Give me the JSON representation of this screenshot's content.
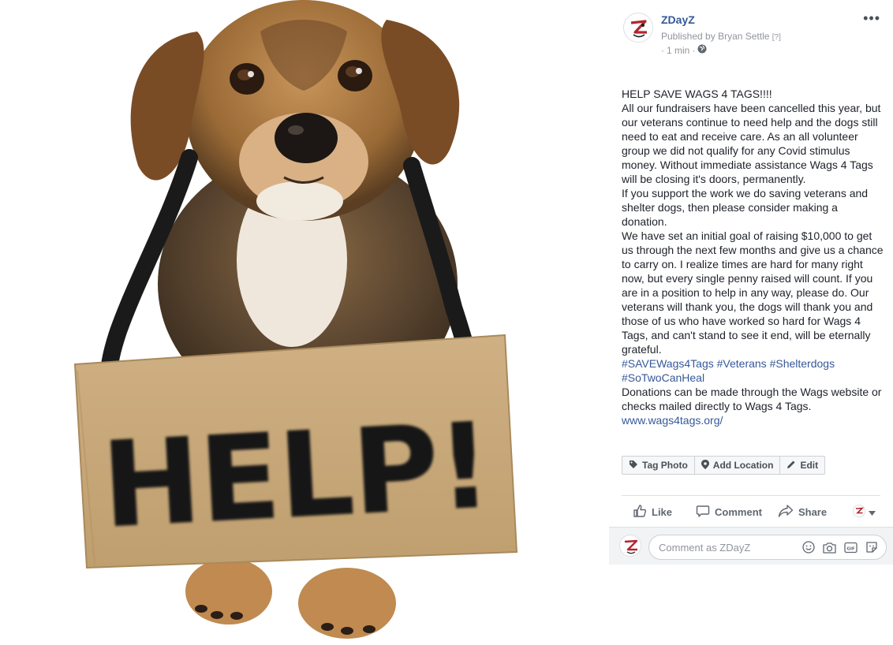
{
  "photo": {
    "sign_text": "HELP!"
  },
  "post": {
    "page_name": "ZDayZ",
    "published_prefix": "Published by",
    "publisher": "Bryan Settle",
    "publisher_help": "[?]",
    "time_prefix": "·",
    "time": "1 min",
    "time_separator": "·",
    "more_label": "•••",
    "body_lines": [
      "HELP SAVE WAGS 4 TAGS!!!!",
      "All our fundraisers have been cancelled this year, but our veterans continue to need help and the dogs still need to eat and receive care. As an all volunteer group we did not qualify for any Covid stimulus money. Without immediate assistance Wags 4 Tags will be closing it's doors, permanently.",
      "If you support the work we do saving veterans and shelter dogs, then please consider making a donation.",
      "We have set an initial goal of raising $10,000 to get us through the next few months and give us a chance to carry on. I realize times are hard for many right now, but every single penny raised will count. If you are in a position to help in any way, please do. Our veterans will thank you, the dogs will thank you and those of us who have worked so hard for Wags 4 Tags, and can't stand to see it end, will be eternally grateful."
    ],
    "hashtags": [
      "#SAVEWags4Tags",
      "#Veterans",
      "#Shelterdogs",
      "#SoTwoCanHeal"
    ],
    "donation_line": "Donations can be made through the Wags website or checks mailed directly to Wags 4 Tags.",
    "website": "www.wags4tags.org/"
  },
  "photo_actions": {
    "tag_photo": "Tag Photo",
    "add_location": "Add Location",
    "edit": "Edit"
  },
  "actions": {
    "like": "Like",
    "comment": "Comment",
    "share": "Share"
  },
  "comment": {
    "placeholder": "Comment as ZDayZ"
  },
  "colors": {
    "link": "#365899",
    "muted": "#90949c",
    "action": "#606770",
    "cardboard": "#c9a978",
    "brand_red": "#b3262e"
  },
  "icons": [
    "globe-icon",
    "tag-icon",
    "location-pin-icon",
    "pencil-icon",
    "thumbs-up-icon",
    "comment-bubble-icon",
    "share-arrow-icon",
    "caret-down-icon",
    "smiley-icon",
    "camera-icon",
    "gif-icon",
    "sticker-icon"
  ]
}
